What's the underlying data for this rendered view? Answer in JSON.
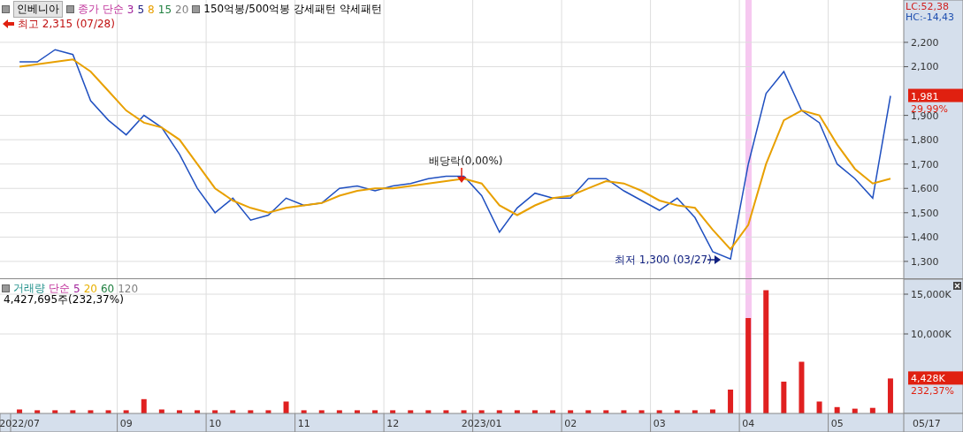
{
  "price_panel": {
    "symbol": "인베니아",
    "legend_title": "종가 단순",
    "legend": [
      {
        "text": "3",
        "color": "#a0209a"
      },
      {
        "text": "5",
        "color": "#202080"
      },
      {
        "text": "8",
        "color": "#e8a000"
      },
      {
        "text": "15",
        "color": "#208040"
      },
      {
        "text": "20",
        "color": "#808080"
      }
    ],
    "extras": [
      "150억봉/500억봉",
      "강세패턴",
      "약세패턴"
    ],
    "lc": "LC:52,38",
    "hc": "HC:-14,43",
    "high_marker": "최고 2,315 (07/28)",
    "event_marker": "배당락(0,00%)",
    "low_marker": "최저 1,300 (03/27)",
    "last_price": "1,981",
    "change": "29,99%",
    "chart_data": {
      "type": "line",
      "grid": true,
      "categories": [
        null,
        null,
        null,
        null,
        null,
        null,
        null,
        null,
        null,
        null,
        null,
        null,
        null,
        null,
        null,
        null,
        null,
        null,
        null,
        null,
        null,
        null,
        null,
        null,
        null,
        null,
        null,
        null,
        null,
        null,
        null,
        null,
        null,
        null,
        null,
        null,
        null,
        null,
        null,
        null,
        null,
        null,
        null,
        null,
        null,
        null,
        null,
        null,
        null,
        null
      ],
      "series": [
        {
          "color": "#2050c0",
          "values": [
            2120,
            2120,
            2170,
            2150,
            1960,
            1880,
            1820,
            1900,
            1850,
            1740,
            1600,
            1500,
            1560,
            1470,
            1490,
            1560,
            1530,
            1540,
            1600,
            1610,
            1590,
            1610,
            1620,
            1640,
            1650,
            1650,
            1570,
            1420,
            1520,
            1580,
            1560,
            1560,
            1640,
            1640,
            1590,
            1550,
            1510,
            1560,
            1480,
            1340,
            1310,
            1700,
            1990,
            2080,
            1920,
            1870,
            1700,
            1640,
            1560,
            1980
          ]
        },
        {
          "color": "#e8a000",
          "values": [
            2100,
            2110,
            2120,
            2130,
            2080,
            2000,
            1920,
            1870,
            1850,
            1800,
            1700,
            1600,
            1550,
            1520,
            1500,
            1520,
            1530,
            1540,
            1570,
            1590,
            1600,
            1600,
            1610,
            1620,
            1630,
            1640,
            1620,
            1530,
            1490,
            1530,
            1560,
            1570,
            1600,
            1630,
            1620,
            1590,
            1550,
            1530,
            1520,
            1430,
            1350,
            1450,
            1700,
            1880,
            1920,
            1900,
            1780,
            1680,
            1620,
            1640
          ]
        }
      ],
      "ylim": [
        1227,
        2374
      ],
      "yticks": [
        {
          "value": 1300,
          "label": "1,300"
        },
        {
          "value": 1400,
          "label": "1,400"
        },
        {
          "value": 1500,
          "label": "1,500"
        },
        {
          "value": 1600,
          "label": "1,600"
        },
        {
          "value": 1700,
          "label": "1,700"
        },
        {
          "value": 1800,
          "label": "1,800"
        },
        {
          "value": 1900,
          "label": "1,900"
        },
        {
          "value": 2100,
          "label": "2,100"
        },
        {
          "value": 2200,
          "label": "2,200"
        }
      ]
    }
  },
  "volume_panel": {
    "title": "거래량",
    "legend_title": "단순",
    "legend": [
      {
        "text": "5",
        "color": "#a0209a"
      },
      {
        "text": "20",
        "color": "#e8b000"
      },
      {
        "text": "60",
        "color": "#208040"
      },
      {
        "text": "120",
        "color": "#808080"
      }
    ],
    "reading": "4,427,695주(232,37%)",
    "last_volume": "4,428K",
    "change": "232,37%",
    "chart_data": {
      "type": "bar",
      "grid": true,
      "categories": [
        "2022/07",
        null,
        null,
        null,
        null,
        null,
        "09",
        null,
        null,
        null,
        null,
        "10",
        null,
        null,
        null,
        null,
        "11",
        null,
        null,
        null,
        null,
        "12",
        null,
        null,
        null,
        null,
        "2023/01",
        null,
        null,
        null,
        null,
        "02",
        null,
        null,
        null,
        null,
        "03",
        null,
        null,
        null,
        null,
        "04",
        null,
        null,
        null,
        null,
        "05",
        null,
        null,
        null
      ],
      "series": [
        {
          "color": "#e02020",
          "values": [
            500,
            400,
            400,
            400,
            400,
            400,
            400,
            1800,
            500,
            400,
            400,
            400,
            400,
            400,
            400,
            1500,
            400,
            400,
            400,
            400,
            400,
            400,
            400,
            400,
            400,
            400,
            400,
            400,
            400,
            400,
            400,
            400,
            400,
            400,
            400,
            400,
            400,
            400,
            400,
            500,
            3000,
            12000,
            15500,
            4000,
            6500,
            1500,
            800,
            600,
            700,
            4400
          ]
        }
      ],
      "ylim": [
        0,
        16889
      ],
      "yticks": [
        {
          "value": 10000,
          "label": "10,000K"
        },
        {
          "value": 15000,
          "label": "15,000K"
        }
      ]
    }
  },
  "x_axis_end": "05/17"
}
